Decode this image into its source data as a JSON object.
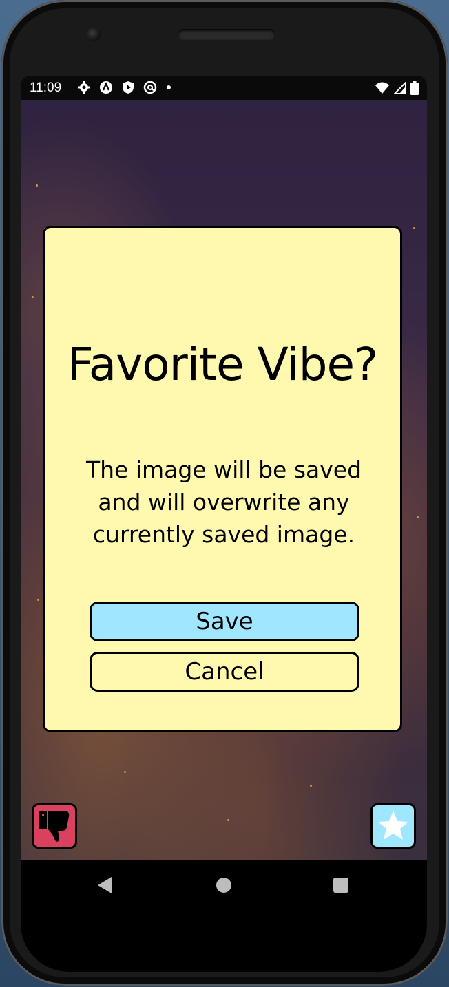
{
  "status_bar": {
    "time": "11:09",
    "left_icons": [
      "gear-icon",
      "app-a-icon",
      "play-shield-icon",
      "at-sign-icon"
    ],
    "right_icons": [
      "wifi-icon",
      "cell-signal-icon",
      "battery-icon"
    ]
  },
  "dialog": {
    "title": "Favorite Vibe?",
    "message": "The image will be saved and will overwrite any currently saved image.",
    "save_label": "Save",
    "cancel_label": "Cancel"
  },
  "fab": {
    "dislike_icon": "thumbs-down-icon",
    "favorite_icon": "star-icon"
  },
  "nav": {
    "back_icon": "back-triangle-icon",
    "home_icon": "home-circle-icon",
    "recents_icon": "recents-square-icon"
  },
  "colors": {
    "dialog_bg": "#fff9b0",
    "save_button_bg": "#a0e6ff",
    "dislike_bg": "#d9415f",
    "favorite_bg": "#9fe6ff"
  }
}
